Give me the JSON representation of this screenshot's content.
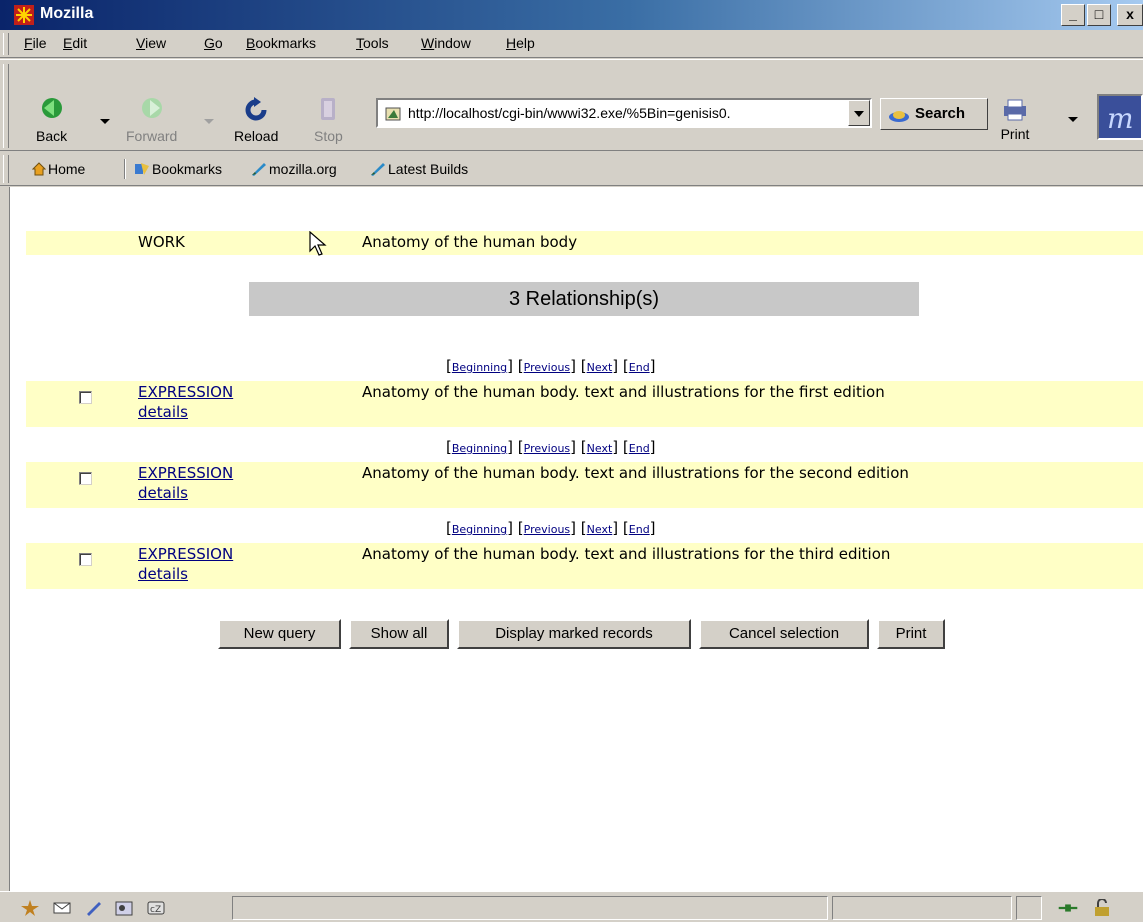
{
  "window": {
    "title": "Mozilla",
    "min": "_",
    "max": "□",
    "close": "x"
  },
  "menu": [
    {
      "pre": "",
      "ul": "F",
      "post": "ile"
    },
    {
      "pre": "",
      "ul": "E",
      "post": "dit"
    },
    {
      "pre": "",
      "ul": "V",
      "post": "iew"
    },
    {
      "pre": "",
      "ul": "G",
      "post": "o"
    },
    {
      "pre": "",
      "ul": "B",
      "post": "ookmarks"
    },
    {
      "pre": "",
      "ul": "T",
      "post": "ools"
    },
    {
      "pre": "",
      "ul": "W",
      "post": "indow"
    },
    {
      "pre": "",
      "ul": "H",
      "post": "elp"
    }
  ],
  "nav": {
    "back": "Back",
    "forward": "Forward",
    "reload": "Reload",
    "stop": "Stop",
    "url": "http://localhost/cgi-bin/wwwi32.exe/%5Bin=genisis0.",
    "search": "Search",
    "print": "Print"
  },
  "personal": {
    "home": "Home",
    "bookmarks": "Bookmarks",
    "mozilla": "mozilla.org",
    "latest": "Latest Builds"
  },
  "work": {
    "label": "WORK",
    "title": "Anatomy of the human body"
  },
  "relationships_header": "3 Relationship(s)",
  "pager": {
    "beginning": "Beginning",
    "previous": "Previous",
    "next": "Next",
    "end": "End"
  },
  "records": [
    {
      "type": "EXPRESSION",
      "details": "details",
      "title": "Anatomy of the human body. text and illustrations for the first edition"
    },
    {
      "type": "EXPRESSION",
      "details": "details",
      "title": "Anatomy of the human body. text and illustrations for the second edition"
    },
    {
      "type": "EXPRESSION",
      "details": "details",
      "title": "Anatomy of the human body. text and illustrations for the third edition"
    }
  ],
  "buttons": {
    "new_query": "New query",
    "show_all": "Show all",
    "display_marked": "Display marked records",
    "cancel_selection": "Cancel selection",
    "print": "Print"
  },
  "colors": {
    "band": "#ffffc6",
    "header": "#c8c8c8",
    "link": "#000080",
    "chrome": "#d4d0c8"
  }
}
